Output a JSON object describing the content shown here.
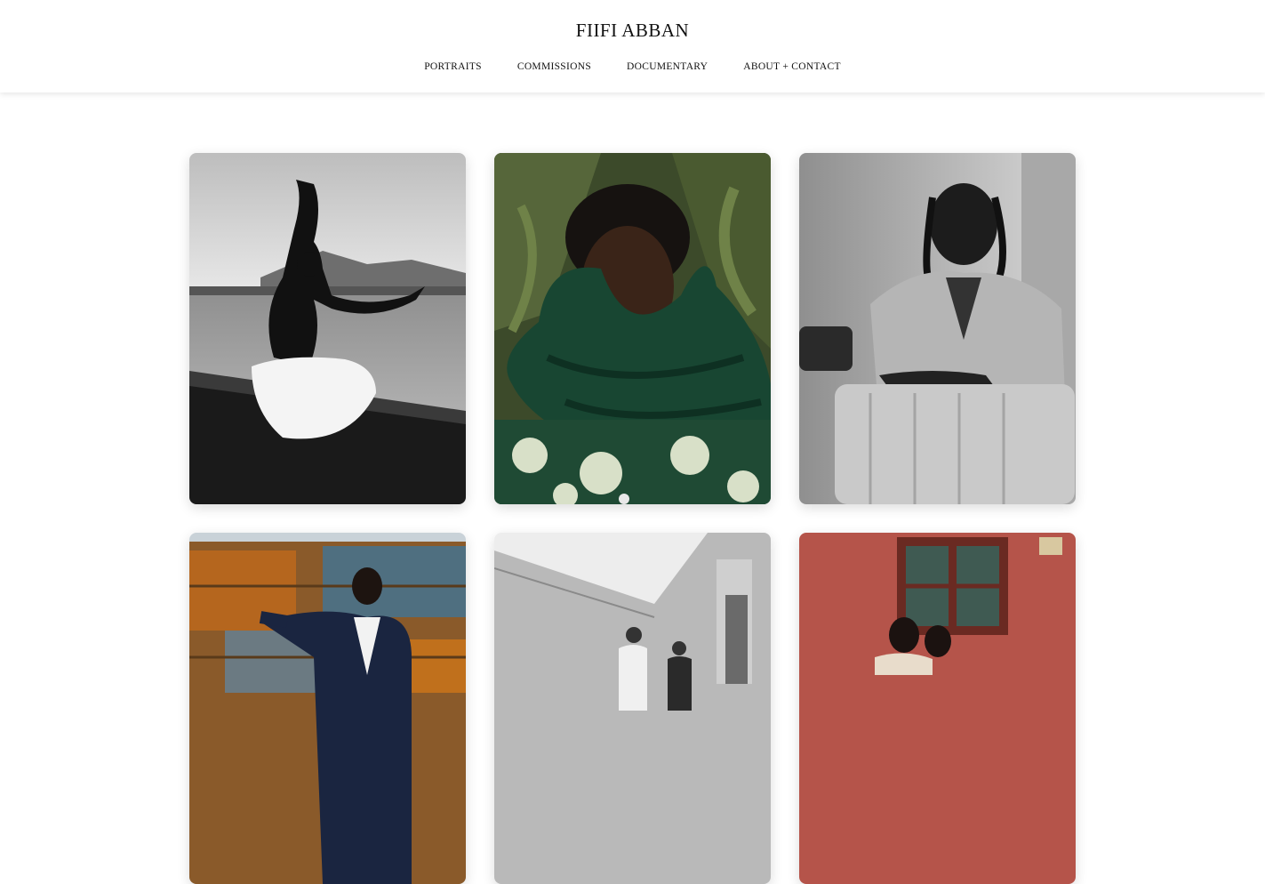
{
  "site": {
    "title": "FIIFI ABBAN"
  },
  "nav": {
    "items": [
      {
        "label": "PORTRAITS"
      },
      {
        "label": "COMMISSIONS"
      },
      {
        "label": "DOCUMENTARY"
      },
      {
        "label": "ABOUT + CONTACT"
      }
    ]
  },
  "gallery": {
    "photos": [
      {
        "subject": "bw-man-in-canoe-arms-raised"
      },
      {
        "subject": "man-in-green-puffer-scarf"
      },
      {
        "subject": "bw-man-leaning-on-suitcase"
      },
      {
        "subject": "man-in-pinstripe-suit-rusty-wall"
      },
      {
        "subject": "bw-two-men-by-white-building"
      },
      {
        "subject": "women-by-red-wall-window"
      }
    ]
  }
}
